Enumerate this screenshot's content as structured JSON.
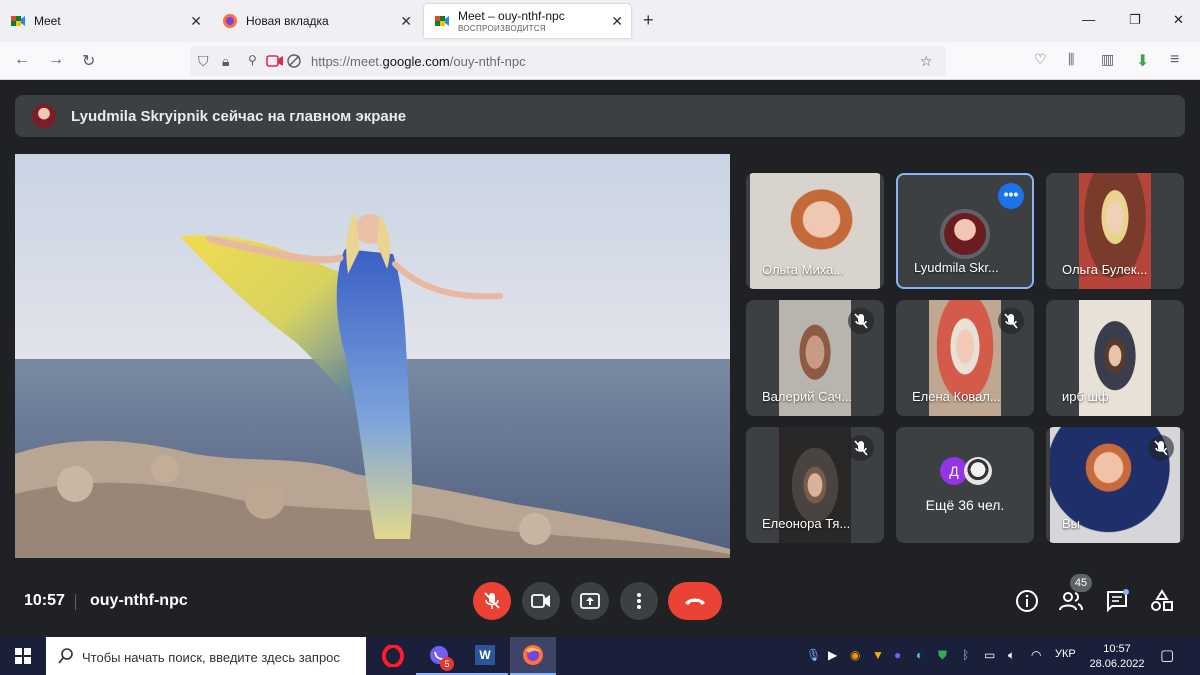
{
  "browser": {
    "tabs": [
      {
        "title": "Meet",
        "subtitle": "",
        "active": false
      },
      {
        "title": "Новая вкладка",
        "subtitle": "",
        "active": false
      },
      {
        "title": "Meet – ouy-nthf-npc",
        "subtitle": "ВОСПРОИЗВОДИТСЯ",
        "active": true
      }
    ],
    "url_prefix": "https://meet.",
    "url_domain": "google.com",
    "url_path": "/ouy-nthf-npc"
  },
  "meet": {
    "banner_text": "Lyudmila Skryipnik сейчас на главном экране",
    "participants": [
      {
        "name": "Ольга Миха...",
        "muted": false
      },
      {
        "name": "Lyudmila Skr...",
        "muted": false,
        "pinned": true
      },
      {
        "name": "Ольга Булек...",
        "muted": false
      },
      {
        "name": "Валерий Сач...",
        "muted": true
      },
      {
        "name": "Елена Ковал...",
        "muted": true
      },
      {
        "name": "ирб шф",
        "muted": false
      },
      {
        "name": "Елеонора Тя...",
        "muted": true
      },
      {
        "name": "Вы",
        "muted": true
      }
    ],
    "more_participants": {
      "avatar_letter": "Д",
      "label": "Ещё 36 чел."
    },
    "more_options_label": "•••",
    "time": "10:57",
    "meeting_code": "ouy-nthf-npc",
    "participant_count": "45"
  },
  "taskbar": {
    "search_placeholder": "Чтобы начать поиск, введите здесь запрос",
    "viber_badge": "5",
    "word_label": "W",
    "language": "УКР",
    "time": "10:57",
    "date": "28.06.2022"
  },
  "colors": {
    "meet_bg": "#202124",
    "tile_bg": "#3c4043",
    "red": "#ea4335",
    "accent_blue": "#1a73e8",
    "taskbar": "#1a1f3a"
  }
}
